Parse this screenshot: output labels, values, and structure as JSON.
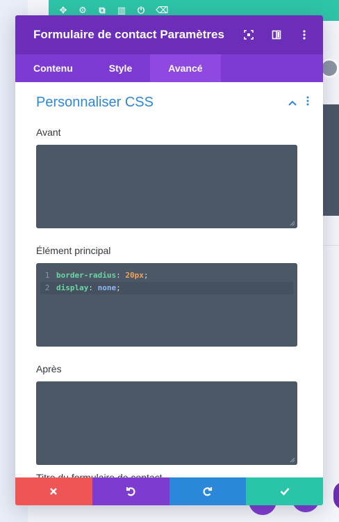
{
  "modal": {
    "title": "Formulaire de contact Paramètres",
    "tabs": [
      {
        "label": "Contenu"
      },
      {
        "label": "Style"
      },
      {
        "label": "Avancé"
      }
    ],
    "active_tab": "Avancé",
    "section_title": "Personnaliser CSS",
    "fields": {
      "before_label": "Avant",
      "main_label": "Élément principal",
      "after_label": "Après",
      "next_label_cut": "Titre du formulaire de contact"
    },
    "code": {
      "line1_num": "1",
      "line1_prop": "border-radius",
      "line1_value": "20px",
      "line2_num": "2",
      "line2_prop": "display",
      "line2_value": "none",
      "colon": ":",
      "semicolon": ";"
    },
    "footer": {
      "cancel_icon": "close-icon",
      "undo_icon": "undo-icon",
      "redo_icon": "redo-icon",
      "save_icon": "check-icon"
    }
  },
  "colors": {
    "header": "#6c2eb9",
    "tabs": "#7d3ad3",
    "active_tab": "#8f48e0",
    "section_title": "#2b87da",
    "code_bg": "#4c5866",
    "cancel": "#ef5555",
    "undo": "#7e3bd0",
    "redo": "#2b87da",
    "save": "#29c4a9",
    "builder_toolbar": "#2ec5a8"
  }
}
